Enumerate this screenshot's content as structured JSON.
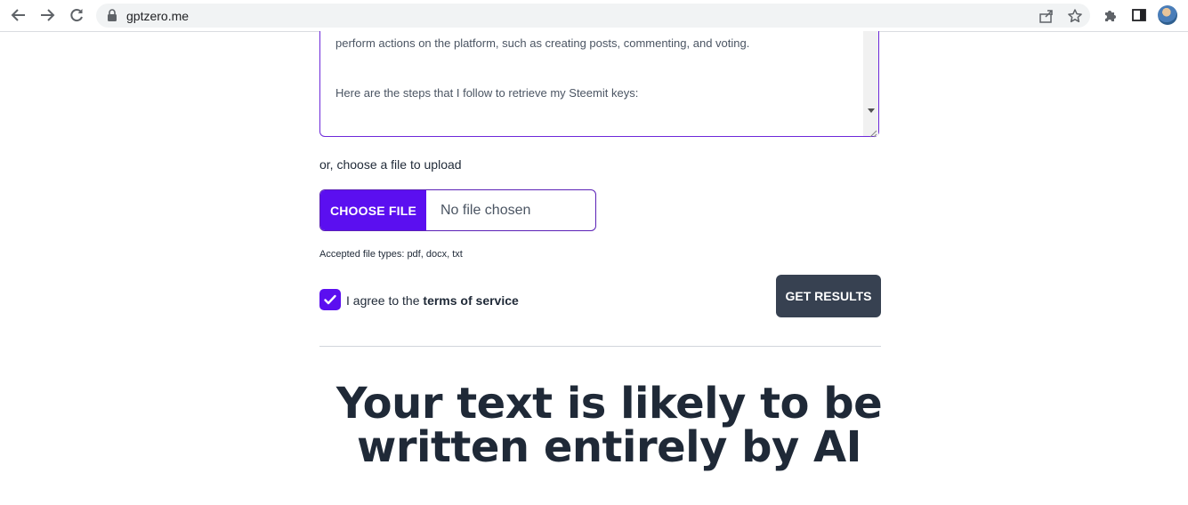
{
  "browser": {
    "url": "gptzero.me",
    "icons": {
      "back": "back-arrow-icon",
      "forward": "forward-arrow-icon",
      "reload": "reload-icon",
      "lock": "lock-icon",
      "share": "share-icon",
      "bookmark": "star-icon",
      "extensions": "puzzle-icon",
      "sidepanel": "side-panel-icon",
      "profile": "avatar"
    }
  },
  "textarea": {
    "line1": "perform actions on the platform, such as creating posts, commenting, and voting.",
    "line2": "Here are the steps that I follow to retrieve my Steemit keys:"
  },
  "upload": {
    "label": "or, choose a file to upload",
    "button": "CHOOSE FILE",
    "status": "No file chosen",
    "accepted": "Accepted file types: pdf, docx, txt"
  },
  "agree": {
    "checked": true,
    "prefix": "I agree to the",
    "link": "terms of service"
  },
  "submit": {
    "label": "GET RESULTS"
  },
  "result": {
    "heading": "Your text is likely to be written entirely by AI"
  },
  "colors": {
    "accent": "#5b0ff0",
    "dark_button": "#374151",
    "heading": "#1f2937"
  }
}
